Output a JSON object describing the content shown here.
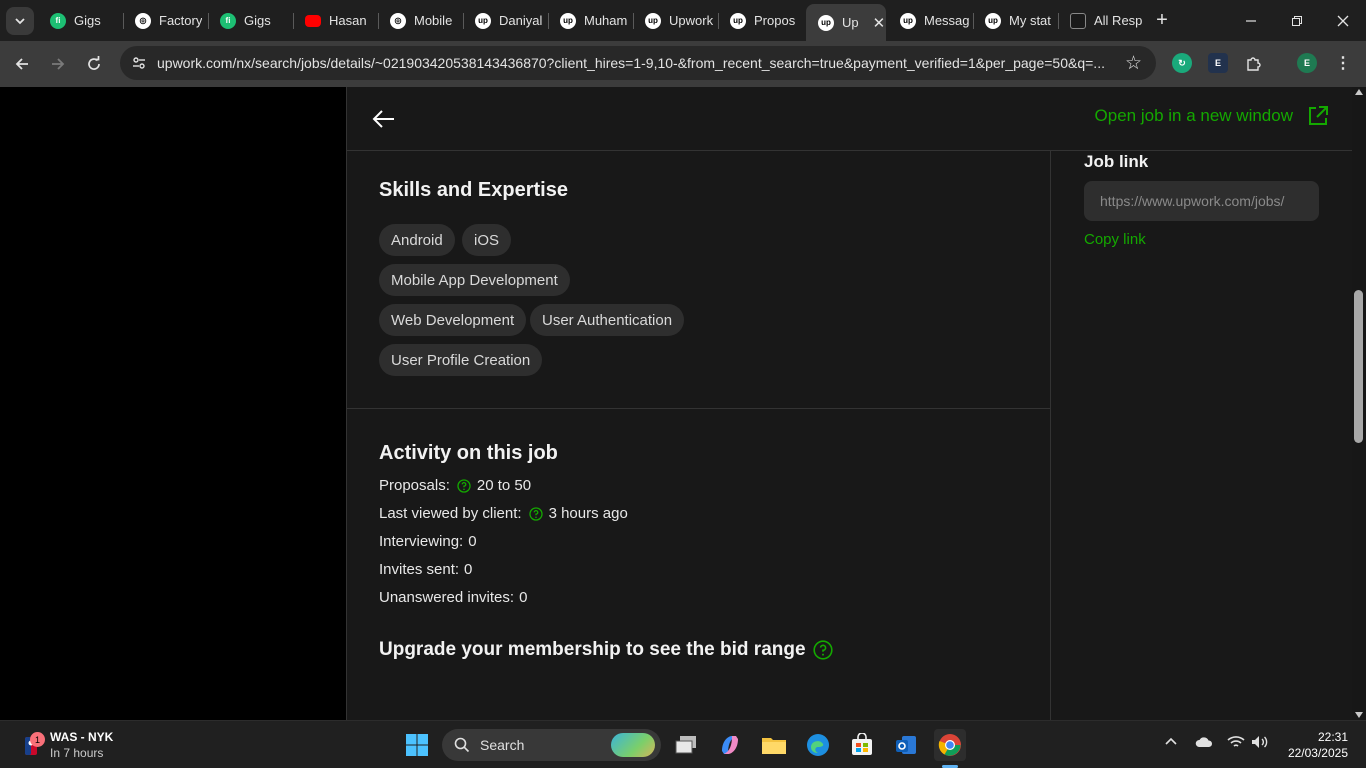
{
  "browser": {
    "tabs": [
      {
        "title": "Gigs",
        "icon": "fiverr-icon"
      },
      {
        "title": "Factory",
        "icon": "openai-icon"
      },
      {
        "title": "Gigs",
        "icon": "fiverr-icon"
      },
      {
        "title": "Hasan",
        "icon": "youtube-icon"
      },
      {
        "title": "Mobile",
        "icon": "openai-icon"
      },
      {
        "title": "Daniyal",
        "icon": "upwork-icon"
      },
      {
        "title": "Muham",
        "icon": "upwork-icon"
      },
      {
        "title": "Upwork",
        "icon": "upwork-icon"
      },
      {
        "title": "Propos",
        "icon": "upwork-icon"
      },
      {
        "title": "Up",
        "icon": "upwork-icon",
        "active": true
      },
      {
        "title": "Messag",
        "icon": "upwork-icon"
      },
      {
        "title": "My stat",
        "icon": "upwork-icon"
      },
      {
        "title": "All Resp",
        "icon": "dark-app-icon"
      }
    ],
    "url": "upwork.com/nx/search/jobs/details/~021903420538143436870?client_hires=1-9,10-&from_recent_search=true&payment_verified=1&per_page=50&q=..."
  },
  "job": {
    "open_new_window_label": "Open job in a new window",
    "skills_title": "Skills and Expertise",
    "skills": [
      "Android",
      "iOS",
      "Mobile App Development",
      "Web Development",
      "User Authentication",
      "User Profile Creation"
    ],
    "activity_title": "Activity on this job",
    "activity": {
      "proposals_label": "Proposals:",
      "proposals_value": "20 to 50",
      "last_viewed_label": "Last viewed by client:",
      "last_viewed_value": "3 hours ago",
      "interviewing_label": "Interviewing:",
      "interviewing_value": "0",
      "invites_sent_label": "Invites sent:",
      "invites_sent_value": "0",
      "unanswered_label": "Unanswered invites:",
      "unanswered_value": "0"
    },
    "upgrade_text": "Upgrade your membership to see the bid range",
    "job_link_title": "Job link",
    "job_link_value": "https://www.upwork.com/jobs/",
    "copy_link_label": "Copy link"
  },
  "taskbar": {
    "weather_title": "WAS - NYK",
    "weather_subtitle": "In 7 hours",
    "badge_count": "1",
    "search_label": "Search",
    "time": "22:31",
    "date": "22/03/2025"
  },
  "colors": {
    "accent_green": "#14a800",
    "panel_bg": "#181818",
    "chip_bg": "#2e2e2e"
  }
}
